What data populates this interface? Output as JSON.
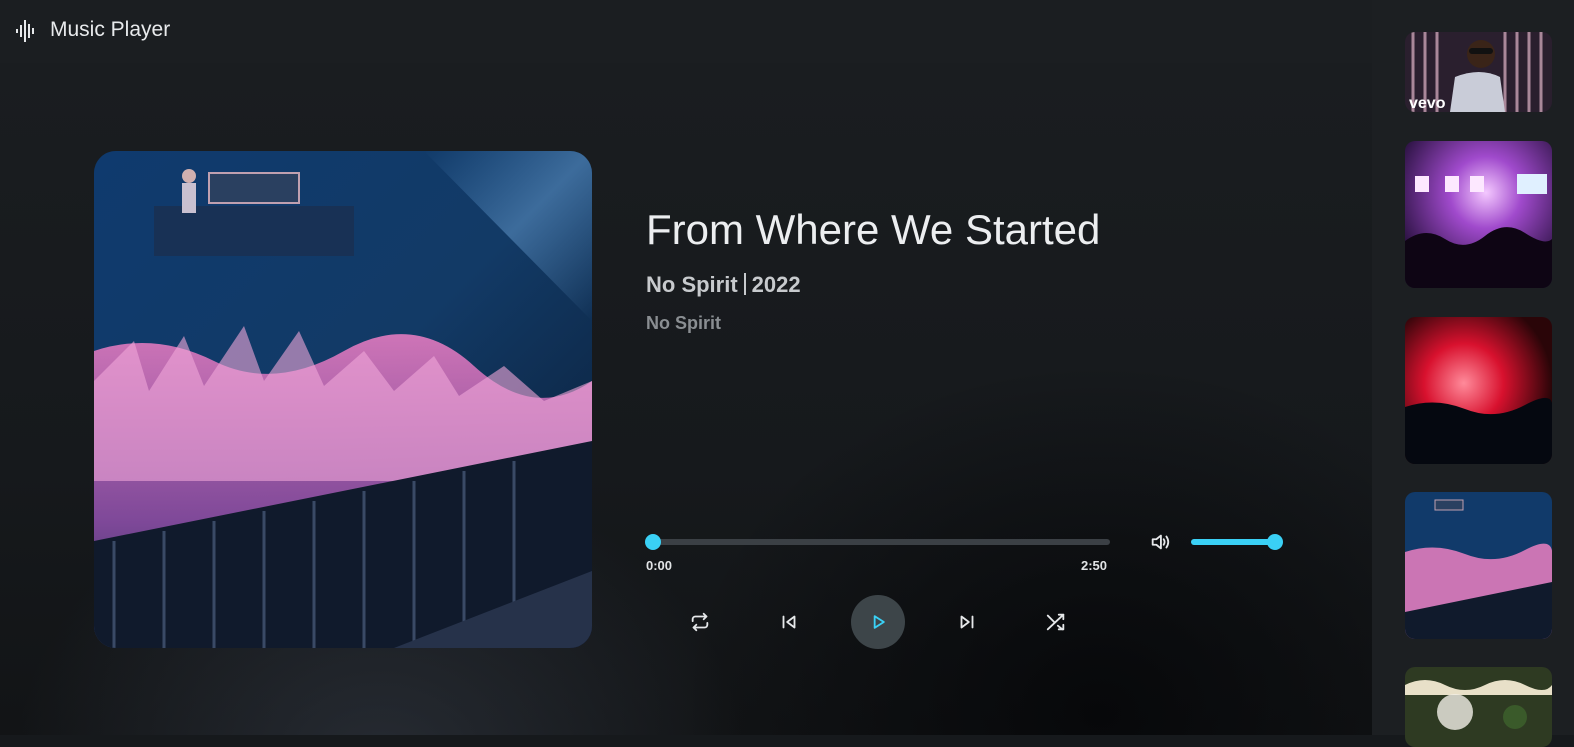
{
  "app": {
    "title": "Music Player"
  },
  "track": {
    "title": "From Where We Started",
    "artist": "No Spirit",
    "year": "2022",
    "artist_subtitle": "No Spirit",
    "album_art_icon": "concert-crowd-image"
  },
  "progress": {
    "current_time": "0:00",
    "total_time": "2:50",
    "fraction": 0
  },
  "volume": {
    "fraction": 1
  },
  "controls": {
    "repeat_icon": "repeat-icon",
    "previous_icon": "skip-previous-icon",
    "play_icon": "play-icon",
    "next_icon": "skip-next-icon",
    "shuffle_icon": "shuffle-icon"
  },
  "playlist": {
    "thumbnails": [
      {
        "image": "vevo-performer-image",
        "overlay_text": "vevo"
      },
      {
        "image": "stage-lights-crowd-image"
      },
      {
        "image": "red-smoke-concert-image"
      },
      {
        "image": "concert-crowd-image"
      },
      {
        "image": "string-lights-image"
      }
    ]
  },
  "colors": {
    "accent": "#3ad0f5",
    "background": "#16191c",
    "topbar": "#1b1e21",
    "sidebar": "#1c1f22",
    "play_button": "#3d4549"
  }
}
